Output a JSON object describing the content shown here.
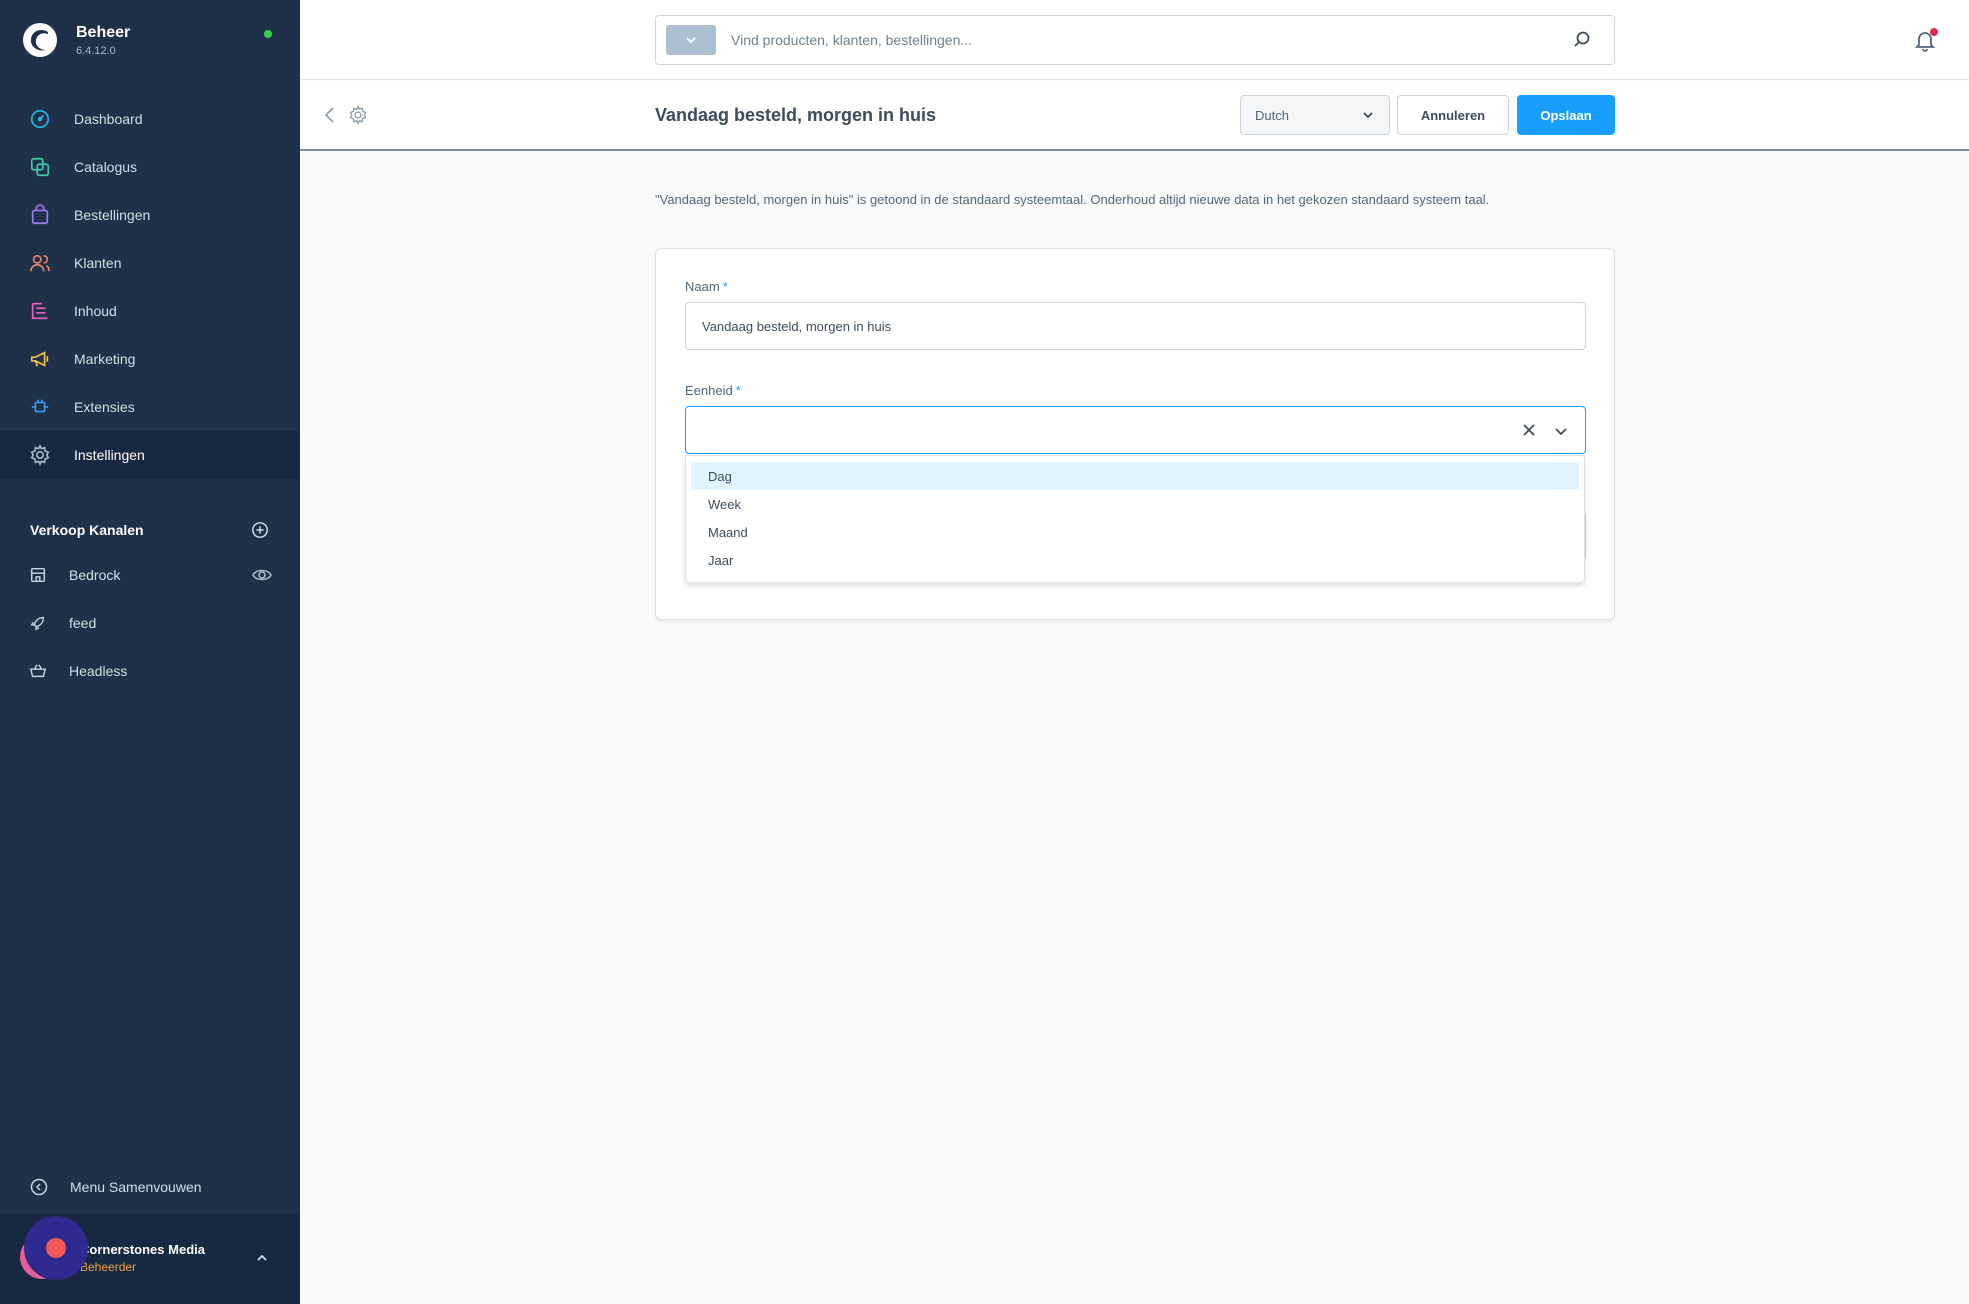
{
  "sidebar": {
    "brand": {
      "title": "Beheer",
      "version": "6.4.12.0"
    },
    "nav": [
      {
        "label": "Dashboard",
        "icon": "dashboard-icon"
      },
      {
        "label": "Catalogus",
        "icon": "catalog-icon"
      },
      {
        "label": "Bestellingen",
        "icon": "orders-icon"
      },
      {
        "label": "Klanten",
        "icon": "customers-icon"
      },
      {
        "label": "Inhoud",
        "icon": "content-icon"
      },
      {
        "label": "Marketing",
        "icon": "marketing-icon"
      },
      {
        "label": "Extensies",
        "icon": "extensions-icon"
      },
      {
        "label": "Instellingen",
        "icon": "settings-icon",
        "active": true
      }
    ],
    "channels_title": "Verkoop Kanalen",
    "channels": [
      {
        "label": "Bedrock",
        "icon": "storefront-icon"
      },
      {
        "label": "feed",
        "icon": "rocket-icon"
      },
      {
        "label": "Headless",
        "icon": "basket-icon"
      }
    ],
    "collapse_label": "Menu Samenvouwen",
    "user": {
      "name": "Cornerstones Media",
      "role": "Beheerder"
    }
  },
  "topbar": {
    "search_placeholder": "Vind producten, klanten, bestellingen..."
  },
  "smartbar": {
    "title": "Vandaag besteld, morgen in huis",
    "language": "Dutch",
    "cancel_label": "Annuleren",
    "save_label": "Opslaan"
  },
  "content": {
    "info": "\"Vandaag besteld, morgen in huis\" is getoond in de standaard systeemtaal. Onderhoud altijd nieuwe data in het gekozen standaard systeem taal.",
    "name_label": "Naam",
    "name_value": "Vandaag besteld, morgen in huis",
    "unit_label": "Eenheid",
    "required_mark": "*",
    "unit_options": [
      "Dag",
      "Week",
      "Maand",
      "Jaar"
    ]
  },
  "colors": {
    "sidebar_bg": "#1f3049",
    "primary": "#189eff",
    "status_online": "#37d046"
  }
}
